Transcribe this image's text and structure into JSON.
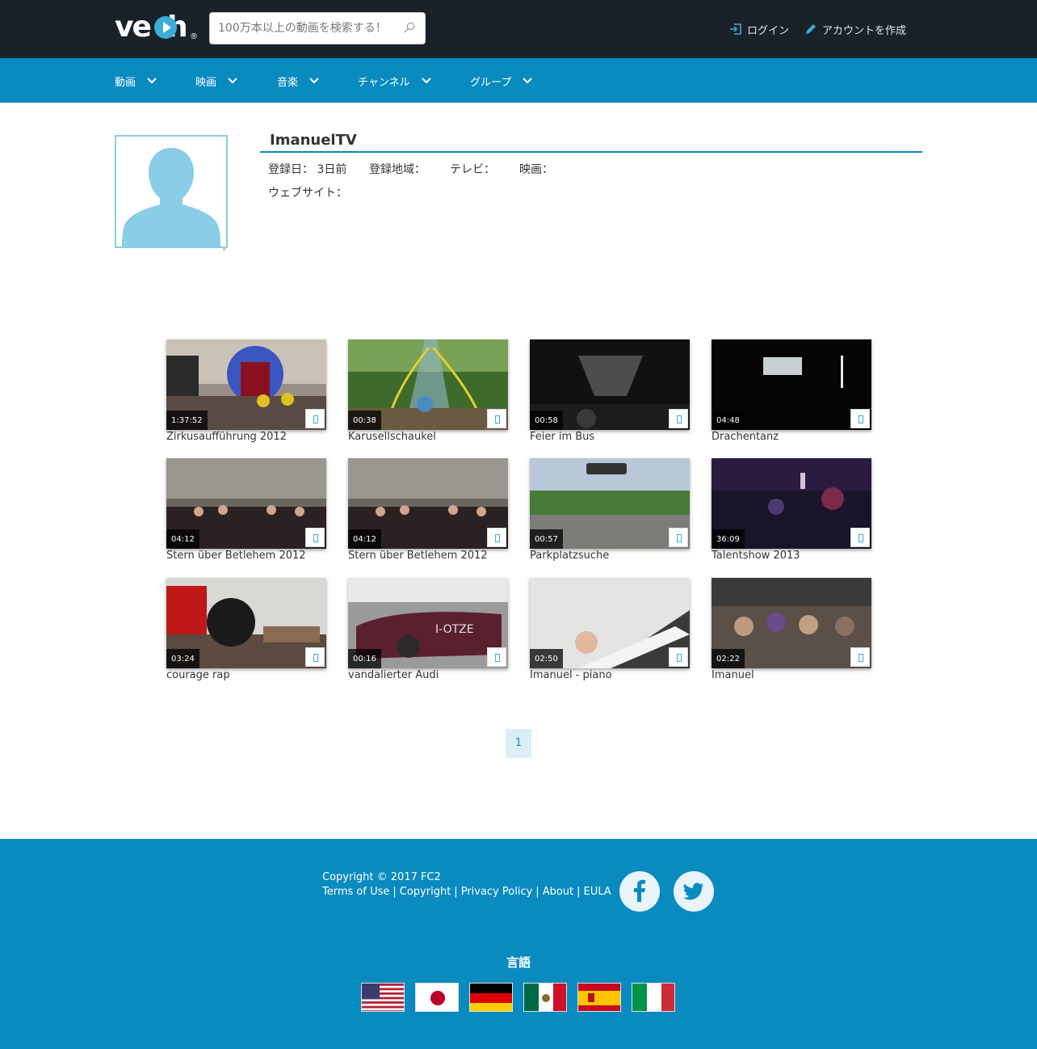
{
  "header": {
    "logo": "veoh",
    "search_placeholder": "100万本以上の動画を検索する！",
    "login_label": "ログイン",
    "signup_label": "アカウントを作成"
  },
  "nav": {
    "items": [
      {
        "label": "動画"
      },
      {
        "label": "映画"
      },
      {
        "label": "音楽"
      },
      {
        "label": "チャンネル"
      },
      {
        "label": "グループ"
      }
    ]
  },
  "profile": {
    "name": "ImanuelTV",
    "registered_label": "登録日：",
    "registered_value": "3日前",
    "region_label": "登録地域：",
    "tv_label": "テレビ：",
    "movies_label": "映画：",
    "website_label": "ウェブサイト："
  },
  "videos": [
    {
      "title": "Zirkusaufführung 2012",
      "duration": "1:37:52"
    },
    {
      "title": "Karusellschaukel",
      "duration": "00:38"
    },
    {
      "title": "Feier im Bus",
      "duration": "00:58"
    },
    {
      "title": "Drachentanz",
      "duration": "04:48"
    },
    {
      "title": "Stern über Betlehem 2012",
      "duration": "04:12"
    },
    {
      "title": "Stern über Betlehem 2012",
      "duration": "04:12"
    },
    {
      "title": "Parkplatzsuche",
      "duration": "00:57"
    },
    {
      "title": "Talentshow 2013",
      "duration": "36:09"
    },
    {
      "title": "courage rap",
      "duration": "03:24"
    },
    {
      "title": "vandalierter Audi",
      "duration": "00:16"
    },
    {
      "title": "Imanuel - piano",
      "duration": "02:50"
    },
    {
      "title": "Imanuel",
      "duration": "02:22"
    }
  ],
  "pagination": {
    "current": "1"
  },
  "footer": {
    "copyright": "Copyright © 2017 FC2",
    "links": [
      "Terms of Use",
      "Copyright",
      "Privacy Policy",
      "About",
      "EULA"
    ],
    "language_title": "言語",
    "flags": [
      "us-flag",
      "jp-flag",
      "de-flag",
      "mx-flag",
      "es-flag",
      "it-flag"
    ]
  },
  "colors": {
    "topbar": "#1a2229",
    "nav": "#0a8bc0",
    "accent": "#3aaed8",
    "footer": "#0a8bc0"
  }
}
